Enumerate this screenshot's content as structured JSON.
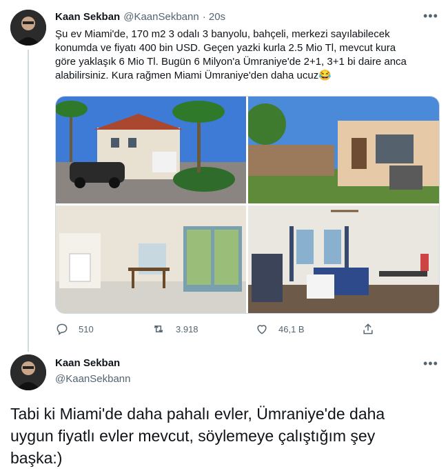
{
  "tweet1": {
    "name": "Kaan Sekban",
    "handle": "@KaanSekbann",
    "time": "· 20s",
    "lines": [
      "Şu ev Miami'de, 170 m2 3 odalı 3 banyolu, bahçeli, merkezi sayılabilecek",
      "konumda ve fiyatı 400 bin USD. Geçen yazki kurla 2.5 Mio Tl, mevcut kura",
      "göre yaklaşık 6 Mio Tl. Bugün 6 Milyon'a Ümraniye'de 2+1, 3+1 bi daire anca",
      "alabilirsiniz. Kura rağmen Miami Ümraniye'den daha ucuz😂"
    ],
    "actions": {
      "replies": "510",
      "retweets": "3.918",
      "likes": "46,1 B"
    },
    "photos": [
      "house-exterior-photo",
      "backyard-photo",
      "kitchen-photo",
      "bedroom-photo"
    ]
  },
  "tweet2": {
    "name": "Kaan Sekban",
    "handle": "@KaanSekbann",
    "lines": [
      "Tabi ki Miami'de daha pahalı evler, Ümraniye'de daha",
      "uygun fiyatlı evler mevcut, söylemeye çalıştığım şey",
      "başka:)"
    ]
  },
  "icons": [
    "avatar",
    "more-icon",
    "reply-icon",
    "retweet-icon",
    "like-icon",
    "share-icon"
  ],
  "colors": {
    "text": "#0f1419",
    "secondary": "#536471",
    "border": "#cfd9de"
  }
}
